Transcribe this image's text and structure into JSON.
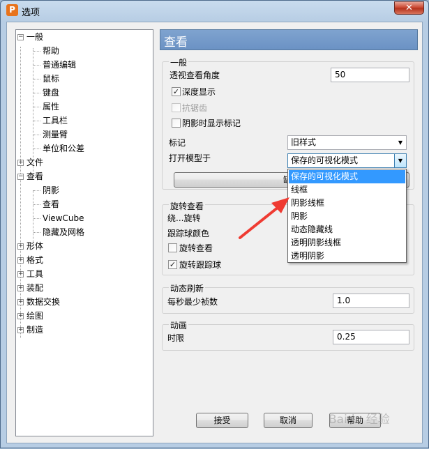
{
  "window": {
    "title": "选项",
    "app_icon_letter": "P",
    "close_glyph": "✕"
  },
  "tree": {
    "collapse_glyph": "−",
    "expand_glyph": "+",
    "items": [
      {
        "label": "一般"
      },
      {
        "label": "帮助"
      },
      {
        "label": "普通编辑"
      },
      {
        "label": "鼠标"
      },
      {
        "label": "键盘"
      },
      {
        "label": "属性"
      },
      {
        "label": "工具栏"
      },
      {
        "label": "测量臂"
      },
      {
        "label": "单位和公差"
      },
      {
        "label": "文件"
      },
      {
        "label": "查看"
      },
      {
        "label": "阴影"
      },
      {
        "label": "查看"
      },
      {
        "label": "ViewCube"
      },
      {
        "label": "隐藏及网格"
      },
      {
        "label": "形体"
      },
      {
        "label": "格式"
      },
      {
        "label": "工具"
      },
      {
        "label": "装配"
      },
      {
        "label": "数据交换"
      },
      {
        "label": "绘图"
      },
      {
        "label": "制造"
      }
    ]
  },
  "panel": {
    "header": "查看",
    "general": {
      "title": "一般",
      "perspective_label": "透视查看角度",
      "perspective_value": "50",
      "depth_display": "深度显示",
      "antialias": "抗锯齿",
      "shadow_markers": "阴影时显示标记",
      "marker_label": "标记",
      "marker_value": "旧样式",
      "open_model_label": "打开模型于",
      "open_model_value": "保存的可视化模式",
      "default_button": "缺省"
    },
    "rotate": {
      "title": "旋转查看",
      "around_label": "绕...旋转",
      "trackball_color_label": "跟踪球颜色",
      "rotate_view": "旋转查看",
      "rotate_trackball": "旋转跟踪球"
    },
    "dynamic": {
      "title": "动态刷新",
      "min_fps_label": "每秒最少祯数",
      "min_fps_value": "1.0"
    },
    "animation": {
      "title": "动画",
      "time_limit_label": "时限",
      "time_limit_value": "0.25"
    },
    "dropdown_options": [
      "保存的可视化模式",
      "线框",
      "阴影线框",
      "阴影",
      "动态隐藏线",
      "透明阴影线框",
      "透明阴影"
    ],
    "check_glyph": "✓",
    "arrow_glyph": "▼"
  },
  "buttons": {
    "accept": "接受",
    "cancel": "取消",
    "help": "帮助"
  },
  "watermark": "Baidu 经验"
}
